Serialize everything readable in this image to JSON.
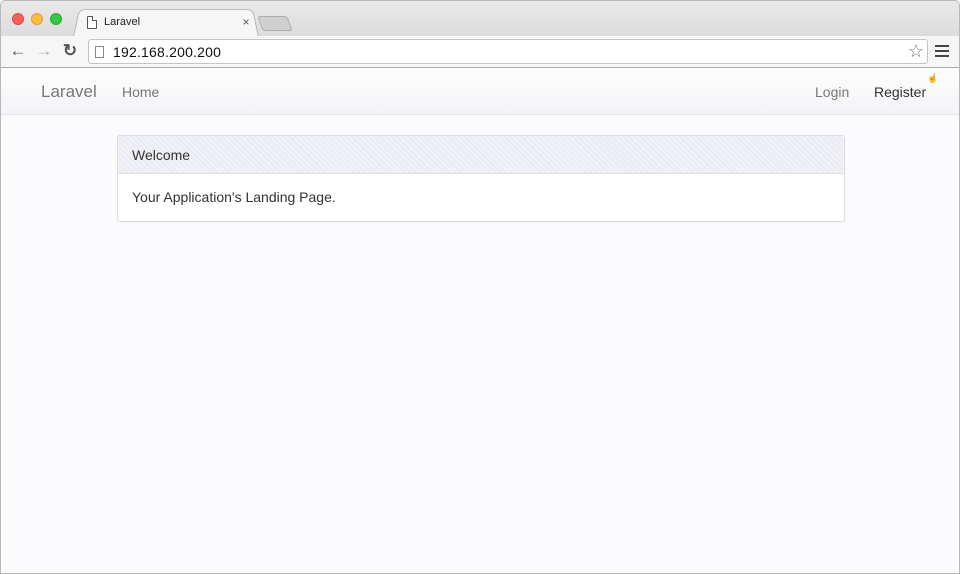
{
  "browser": {
    "tab_title": "Laravel",
    "tab_close": "×",
    "url": "192.168.200.200",
    "back_icon": "arrow-left-icon",
    "forward_icon": "arrow-right-icon",
    "reload_icon": "reload-icon",
    "star_icon": "star-icon",
    "menu_icon": "hamburger-menu-icon"
  },
  "navbar": {
    "brand": "Laravel",
    "home": "Home",
    "login": "Login",
    "register": "Register"
  },
  "panel": {
    "heading": "Welcome",
    "body": "Your Application's Landing Page."
  }
}
